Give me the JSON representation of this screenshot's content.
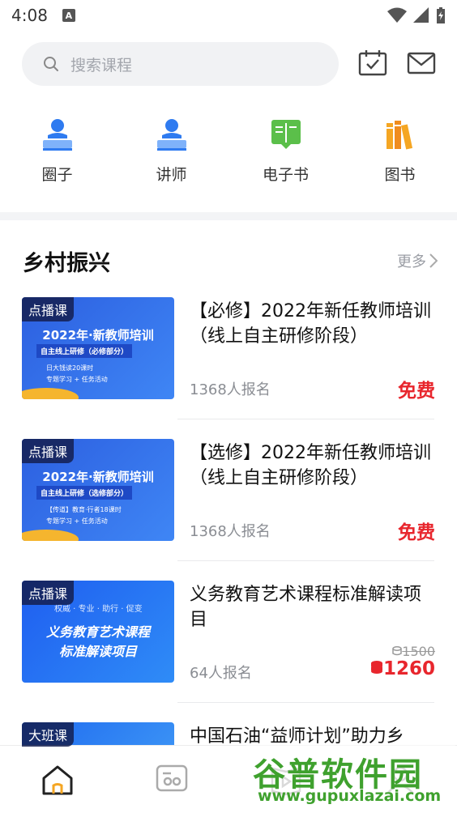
{
  "status_bar": {
    "time": "4:08",
    "notif_letter": "A"
  },
  "search": {
    "placeholder": "搜索课程"
  },
  "quick_nav": [
    {
      "label": "圈子",
      "icon": "teacher-icon"
    },
    {
      "label": "讲师",
      "icon": "lecturer-icon"
    },
    {
      "label": "电子书",
      "icon": "ebook-icon"
    },
    {
      "label": "图书",
      "icon": "books-icon"
    }
  ],
  "section": {
    "title": "乡村振兴",
    "more": "更多"
  },
  "courses": [
    {
      "badge": "点播课",
      "thumb_title": "2022年·新教师培训",
      "thumb_sub": "自主线上研修（必修部分）",
      "thumb_line1": "日大钱读20课时",
      "thumb_line2": "专题学习 + 任务活动",
      "title": "【必修】2022年新任教师培训（线上自主研修阶段）",
      "enroll": "1368人报名",
      "price": "免费"
    },
    {
      "badge": "点播课",
      "thumb_title": "2022年·新教师培训",
      "thumb_sub": "自主线上研修（选修部分）",
      "thumb_line1": "【传道】教育·行者18课时",
      "thumb_line2": "专题学习 + 任务活动",
      "title": "【选修】2022年新任教师培训（线上自主研修阶段）",
      "enroll": "1368人报名",
      "price": "免费"
    },
    {
      "badge": "点播课",
      "thumb_top": "权威 · 专业 · 助行 · 促变",
      "thumb_title": "义务教育艺术课程",
      "thumb_sub": "标准解读项目",
      "title": "义务教育艺术课程标准解读项目",
      "enroll": "64人报名",
      "original_price": "1500",
      "price": "1260"
    },
    {
      "badge": "大班课",
      "title": "中国石油“益师计划”助力乡"
    }
  ],
  "tabbar": [
    {
      "name": "home-tab",
      "icon": "home-icon"
    },
    {
      "name": "class-tab",
      "icon": "group-icon"
    },
    {
      "name": "video-tab",
      "icon": "play-book-icon"
    },
    {
      "name": "me-tab",
      "icon": "user-icon"
    }
  ],
  "watermark": {
    "big": "谷普软件园",
    "small": "www.gupuxlazai.com"
  },
  "colors": {
    "accent": "#e8262d",
    "blue": "#2f7bf0",
    "green": "#5bbf4a",
    "orange": "#f5a623"
  }
}
